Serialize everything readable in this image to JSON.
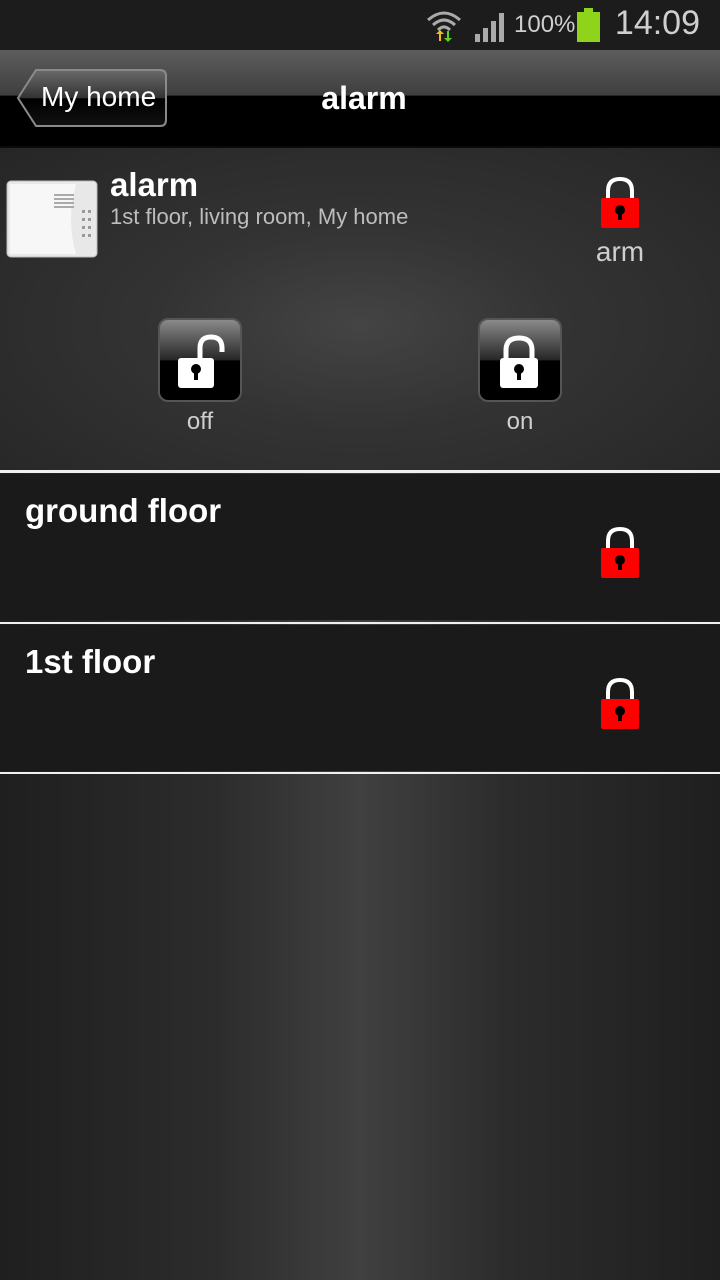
{
  "status_bar": {
    "battery_percent": "100%",
    "time": "14:09",
    "icons": [
      "wifi-icon",
      "signal-icon",
      "battery-icon"
    ]
  },
  "action_bar": {
    "back_label": "My home",
    "title": "alarm"
  },
  "alarm": {
    "name": "alarm",
    "location": "1st floor, living room, My home",
    "status": "arm",
    "status_color": "#ff0000",
    "modes": [
      {
        "label": "off",
        "icon": "unlocked-padlock-icon"
      },
      {
        "label": "on",
        "icon": "locked-padlock-icon"
      }
    ]
  },
  "zones": [
    {
      "name": "ground floor",
      "icon": "red-padlock-icon"
    },
    {
      "name": "1st floor",
      "icon": "red-padlock-icon"
    }
  ]
}
